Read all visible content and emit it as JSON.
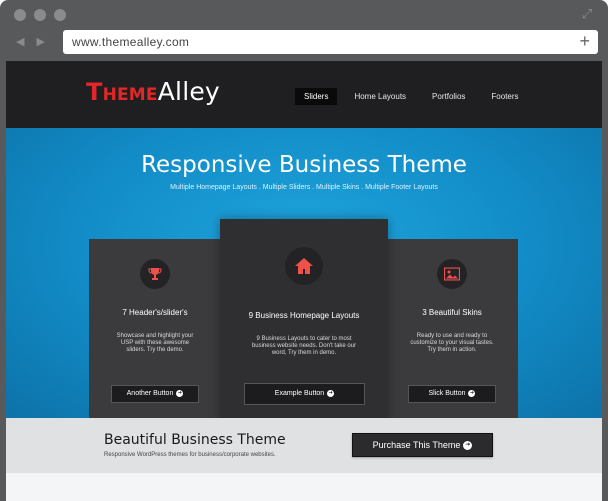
{
  "browser": {
    "url": "www.themealley.com",
    "back_glyph": "◀",
    "forward_glyph": "▶",
    "new_tab_glyph": "+",
    "expand_glyph": "⤢"
  },
  "site": {
    "logo": {
      "part1": "Theme",
      "part2": "Alley",
      "accent": "#e12727"
    },
    "menu": [
      {
        "label": "Sliders",
        "active": true
      },
      {
        "label": "Home Layouts",
        "active": false
      },
      {
        "label": "Portfolios",
        "active": false
      },
      {
        "label": "Footers",
        "active": false
      }
    ],
    "hero": {
      "title": "Responsive Business Theme",
      "subtitle": "Multiple Homepage Layouts . Multiple Sliders . Multiple Skins . Multiple Footer Layouts"
    },
    "cards": [
      {
        "icon": "trophy-icon",
        "title": "7 Header's/slider's",
        "text": "Showcase and highlight your USP with these awesome sliders. Try the demo.",
        "button": "Another Button",
        "button_icon": "➜"
      },
      {
        "icon": "home-icon",
        "title": "9 Business Homepage Layouts",
        "text": "9 Business Layouts to cater to most business website needs. Don't take our word, Try them in demo.",
        "button": "Example Button",
        "button_icon": "➜"
      },
      {
        "icon": "image-icon",
        "title": "3 Beautiful Skins",
        "text": "Ready to use and ready to customize to your visual tastes. Try them in action.",
        "button": "Slick Button",
        "button_icon": "➜"
      }
    ],
    "cta": {
      "title": "Beautiful Business Theme",
      "subtitle": "Responsive WordPress themes for business/corporate websites.",
      "button": "Purchase This Theme",
      "button_icon": "➜"
    },
    "colors": {
      "hero_blue": "#128bc6",
      "icon_red": "#f0504a",
      "topbar": "#1f1f21",
      "card": "#3b3b3e"
    }
  }
}
